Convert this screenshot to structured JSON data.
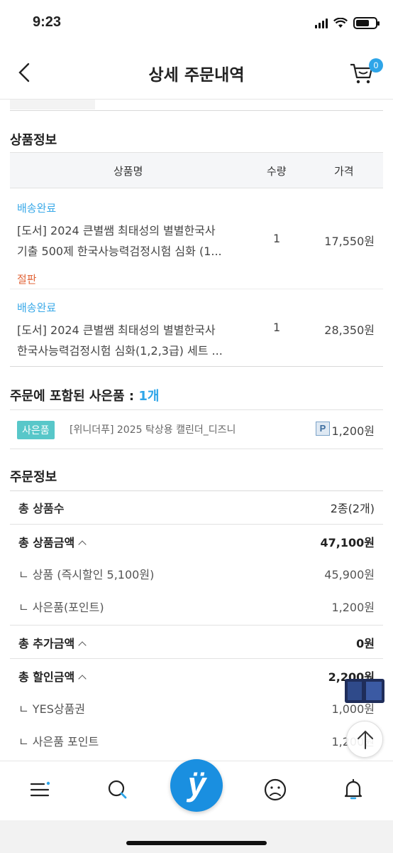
{
  "status": {
    "time": "9:23"
  },
  "header": {
    "title": "상세 주문내역",
    "cart_count": "0"
  },
  "product_section": {
    "title": "상품정보",
    "columns": {
      "name": "상품명",
      "qty": "수량",
      "price": "가격"
    },
    "items": [
      {
        "status": "배송완료",
        "name_line1": "[도서] 2024 큰별쌤 최태성의 별별한국사",
        "name_line2": "기출 500제 한국사능력검정시험 심화 (1...",
        "qty": "1",
        "price": "17,550원",
        "note": "절판"
      },
      {
        "status": "배송완료",
        "name_line1": "[도서] 2024 큰별쌤 최태성의 별별한국사",
        "name_line2": "한국사능력검정시험 심화(1,2,3급) 세트 ...",
        "qty": "1",
        "price": "28,350원"
      }
    ]
  },
  "gift_section": {
    "title": "주문에 포함된 사은품 :",
    "count": "1개",
    "badge": "사은품",
    "item": "[위니더푸] 2025 탁상용 캘린더_디즈니",
    "point_icon": "P",
    "price": "1,200원"
  },
  "order_section": {
    "title": "주문정보",
    "rows": {
      "total_count": {
        "label": "총 상품수",
        "value": "2종(2개)"
      },
      "total_amount": {
        "label": "총 상품금액",
        "value": "47,100원"
      },
      "product": {
        "label": "ㄴ 상품 (즉시할인 5,100원)",
        "value": "45,900원"
      },
      "gift_point": {
        "label": "ㄴ 사은품(포인트)",
        "value": "1,200원"
      },
      "extra_amount": {
        "label": "총 추가금액",
        "value": "0원"
      },
      "discount_amount": {
        "label": "총 할인금액",
        "value": "2,200원"
      },
      "yes_voucher": {
        "label": "ㄴ YES상품권",
        "value": "1,000원"
      },
      "gift_point_discount": {
        "label": "ㄴ 사은품 포인트",
        "value": "1,200원"
      }
    }
  },
  "tabbar": {
    "items": [
      "menu-icon",
      "search-icon",
      "home-logo-icon",
      "my-page-icon",
      "notification-bell-icon"
    ],
    "home_logo_text": "ÿ"
  },
  "colors": {
    "accent": "#2ea5e8",
    "gift_badge": "#58c7c9",
    "soldout": "#e2663a",
    "home_button": "#1a8fe0"
  }
}
